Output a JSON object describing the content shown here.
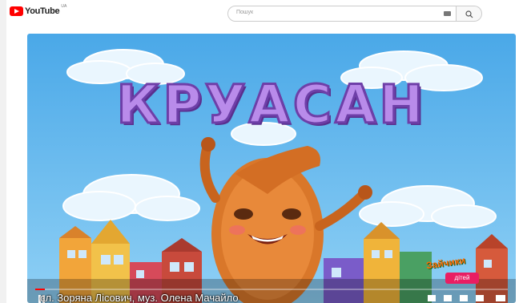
{
  "header": {
    "logo_text": "YouTube",
    "region": "UA",
    "search_placeholder": "Пошук"
  },
  "video": {
    "title_art": "КРУАСАН",
    "caption": "сл. Зоряна Ліcович, муз. Олена Мачайло",
    "channel_logo_text": "Зайчики",
    "channel_badge": "дітей",
    "progress": 0.02
  },
  "icons": [
    "keyboard-icon",
    "search-icon",
    "play-pause-icon",
    "settings-icon",
    "fullscreen-icon"
  ]
}
